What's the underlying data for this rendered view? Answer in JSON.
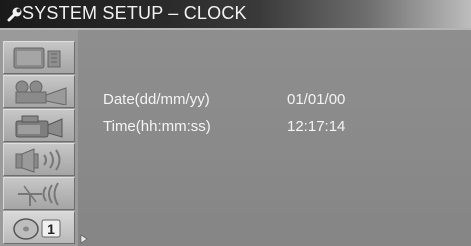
{
  "title": "SYSTEM SETUP – CLOCK",
  "icons": {
    "title": "wrench-icon",
    "sidebar": [
      "monitor-icon",
      "movie-camera-icon",
      "camcorder-icon",
      "speaker-icon",
      "antenna-icon",
      "disc-icon"
    ]
  },
  "sidebar": {
    "disc_badge": "1"
  },
  "clock": {
    "date_label": "Date(dd/mm/yy)",
    "date_value": "01/01/00",
    "time_label": "Time(hh:mm:ss)",
    "time_value": "12:17:14"
  }
}
